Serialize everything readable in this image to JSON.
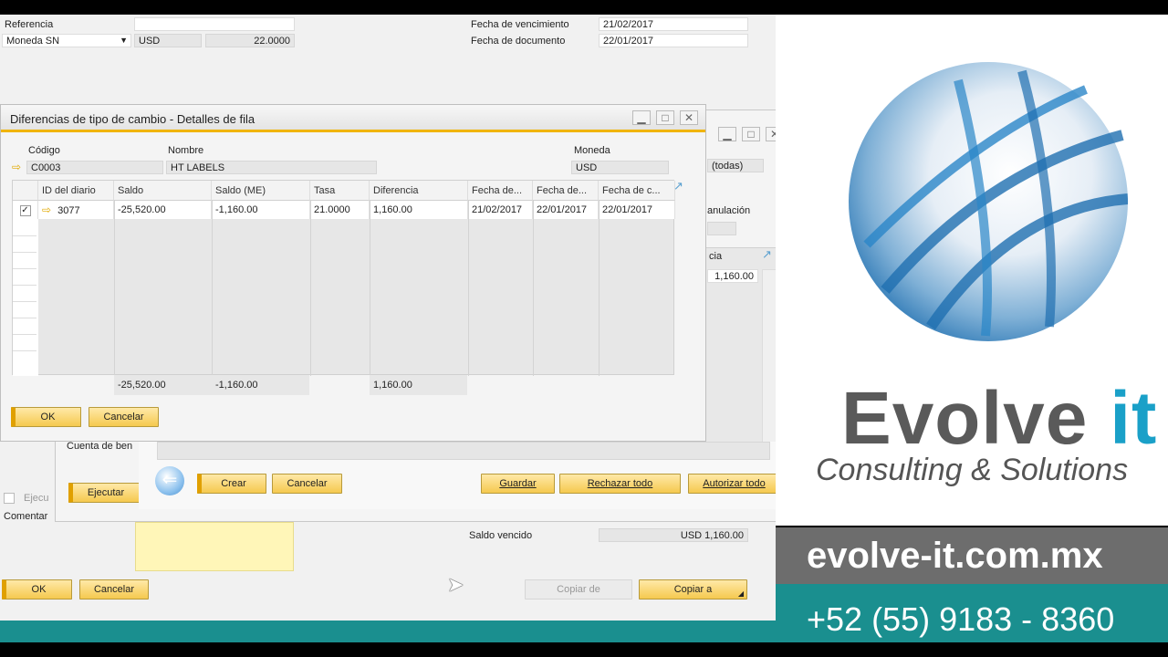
{
  "sap_form": {
    "referencia_label": "Referencia",
    "moneda_sn": "Moneda SN",
    "currency": "USD",
    "rate": "22.0000",
    "fecha_venc_label": "Fecha de vencimiento",
    "fecha_venc_value": "21/02/2017",
    "fecha_doc_label": "Fecha de documento",
    "fecha_doc_value": "22/01/2017",
    "saldo_vencido_label": "Saldo vencido",
    "saldo_vencido_value": "USD 1,160.00",
    "ok_label": "OK",
    "cancel_label": "Cancelar",
    "copiar_de_label": "Copiar de",
    "copiar_a_label": "Copiar a",
    "comentarios_label": "Comentar",
    "ejecutar_check_label": "Ejecu"
  },
  "mid_window": {
    "todas_label": "(todas)",
    "anulacion_label": "anulación",
    "cia_label": "cia",
    "value_label": "1,160.00",
    "cuenta_label": "Cuenta de ben",
    "ejecutar_label": "Ejecutar",
    "crear_label": "Crear",
    "cancelar_label": "Cancelar",
    "guardar_label": "Guardar",
    "rechazar_label": "Rechazar todo",
    "autorizar_label": "Autorizar todo"
  },
  "dialog": {
    "title": "Diferencias de tipo de cambio - Detalles de fila",
    "codigo_label": "Código",
    "codigo_value": "C0003",
    "nombre_label": "Nombre",
    "nombre_value": "HT LABELS",
    "moneda_label": "Moneda",
    "moneda_value": "USD",
    "columns": [
      "ID del diario",
      "Saldo",
      "Saldo (ME)",
      "Tasa",
      "Diferencia",
      "Fecha de...",
      "Fecha de...",
      "Fecha de c..."
    ],
    "row": {
      "id": "3077",
      "saldo": "-25,520.00",
      "saldo_me": "-1,160.00",
      "tasa": "21.0000",
      "diferencia": "1,160.00",
      "fecha1": "21/02/2017",
      "fecha2": "22/01/2017",
      "fecha3": "22/01/2017"
    },
    "totals": {
      "saldo": "-25,520.00",
      "saldo_me": "-1,160.00",
      "diferencia": "1,160.00"
    },
    "ok_label": "OK",
    "cancel_label": "Cancelar"
  },
  "brand": {
    "name_main": "Evolve",
    "name_accent": "it",
    "tagline": "Consulting & Solutions",
    "url": "evolve-it.com.mx",
    "phone": "+52 (55) 9183 - 8360"
  },
  "colors": {
    "accent_yellow": "#f5c94f",
    "teal": "#1a8f8f",
    "brand_blue": "#1aa0c8"
  }
}
